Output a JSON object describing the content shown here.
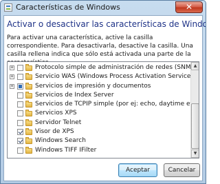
{
  "window": {
    "title": "Características de Windows",
    "close_glyph": "✕"
  },
  "header": {
    "heading": "Activar o desactivar las características de Windows",
    "description": "Para activar una característica, active la casilla correspondiente. Para desactivarla, desactive la casilla. Una casilla rellena indica que sólo está activada una parte de la característica."
  },
  "features": [
    {
      "label": "Protocolo simple de administración de redes (SNMP)",
      "expander": "+",
      "state": "unchecked"
    },
    {
      "label": "Servicio WAS (Windows Process Activation Service)",
      "expander": "+",
      "state": "unchecked"
    },
    {
      "label": "Servicios de impresión y documentos",
      "expander": "+",
      "state": "partial"
    },
    {
      "label": "Servicios de Index Server",
      "expander": "",
      "state": "unchecked"
    },
    {
      "label": "Servicios de TCPIP simple (por ej: echo, daytime etc)",
      "expander": "",
      "state": "unchecked"
    },
    {
      "label": "Servicios XPS",
      "expander": "",
      "state": "unchecked"
    },
    {
      "label": "Servidor Telnet",
      "expander": "",
      "state": "unchecked"
    },
    {
      "label": "Visor de XPS",
      "expander": "",
      "state": "checked"
    },
    {
      "label": "Windows Search",
      "expander": "",
      "state": "checked"
    },
    {
      "label": "Windows TIFF IFilter",
      "expander": "",
      "state": "unchecked"
    }
  ],
  "buttons": {
    "accept": "Aceptar",
    "cancel": "Cancelar"
  },
  "icons": {
    "app": "windows-features-icon",
    "folder": "folder-icon",
    "scroll_up": "▲",
    "scroll_down": "▼"
  }
}
